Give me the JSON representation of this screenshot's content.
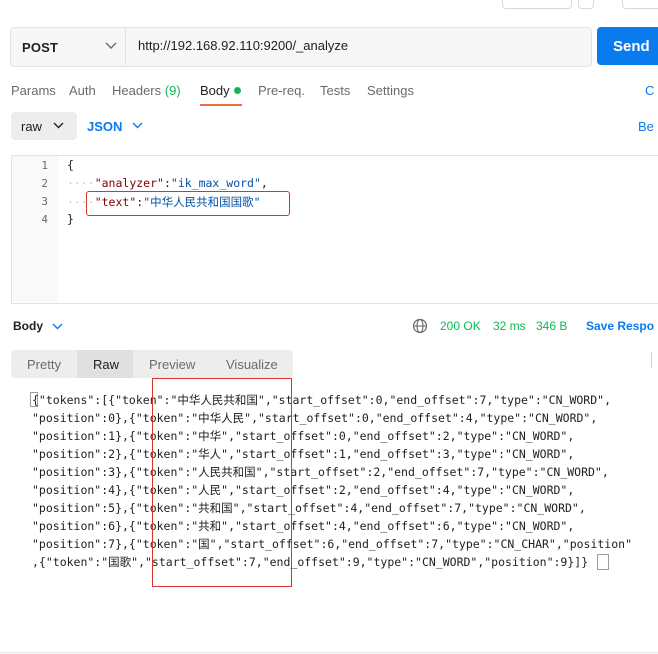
{
  "request": {
    "method": "POST",
    "url": "http://192.168.92.110:9200/_analyze",
    "send_label": "Send"
  },
  "tabs": [
    {
      "label": "Params"
    },
    {
      "label": "Auth"
    },
    {
      "label": "Headers",
      "count": "(9)"
    },
    {
      "label": "Body"
    },
    {
      "label": "Pre-req."
    },
    {
      "label": "Tests"
    },
    {
      "label": "Settings"
    }
  ],
  "tabs_cut_label": "C",
  "body_type": {
    "mode": "raw",
    "format": "JSON",
    "beautify_cut": "Be"
  },
  "editor": {
    "line_numbers": [
      "1",
      "2",
      "3",
      "4"
    ],
    "open_brace": "{",
    "close_brace": "}",
    "key_analyzer": "\"analyzer\"",
    "val_analyzer": "\"ik_max_word\"",
    "key_text": "\"text\"",
    "val_text": "\"中华人民共和国国歌\""
  },
  "response": {
    "section_label": "Body",
    "status": "200 OK",
    "time": "32 ms",
    "size": "346 B",
    "save_label": "Save Respo",
    "view_tabs": [
      "Pretty",
      "Raw",
      "Preview",
      "Visualize"
    ],
    "active_view": "Raw",
    "lines": [
      "{\"tokens\":[{\"token\":\"中华人民共和国\",\"start_offset\":0,\"end_offset\":7,\"type\":\"CN_WORD\",",
      "\"position\":0},{\"token\":\"中华人民\",\"start_offset\":0,\"end_offset\":4,\"type\":\"CN_WORD\",",
      "\"position\":1},{\"token\":\"中华\",\"start_offset\":0,\"end_offset\":2,\"type\":\"CN_WORD\",",
      "\"position\":2},{\"token\":\"华人\",\"start_offset\":1,\"end_offset\":3,\"type\":\"CN_WORD\",",
      "\"position\":3},{\"token\":\"人民共和国\",\"start_offset\":2,\"end_offset\":7,\"type\":\"CN_WORD\",",
      "\"position\":4},{\"token\":\"人民\",\"start_offset\":2,\"end_offset\":4,\"type\":\"CN_WORD\",",
      "\"position\":5},{\"token\":\"共和国\",\"start_offset\":4,\"end_offset\":7,\"type\":\"CN_WORD\",",
      "\"position\":6},{\"token\":\"共和\",\"start_offset\":4,\"end_offset\":6,\"type\":\"CN_WORD\",",
      "\"position\":7},{\"token\":\"国\",\"start_offset\":6,\"end_offset\":7,\"type\":\"CN_CHAR\",\"position\"",
      ",{\"token\":\"国歌\",\"start_offset\":7,\"end_offset\":9,\"type\":\"CN_WORD\",\"position\":9}]}"
    ]
  },
  "icons": {
    "method_chevron": "chevron-down-icon",
    "format_chevron": "chevron-down-icon",
    "body_chevron": "chevron-down-icon",
    "globe": "globe-icon"
  },
  "colors": {
    "send": "#097bed",
    "active_tab_underline": "#f26b3a",
    "status_ok": "#0cbb52",
    "highlight_box": "#d9342b"
  }
}
